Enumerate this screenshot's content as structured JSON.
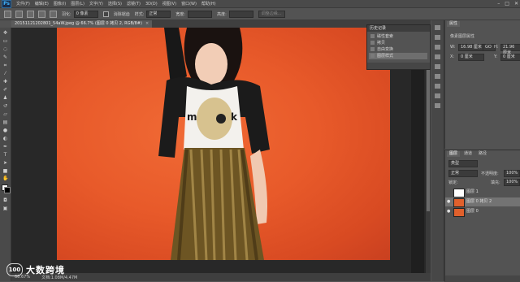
{
  "app": {
    "logo": "Ps"
  },
  "menubar": {
    "items": [
      "文件(F)",
      "编辑(E)",
      "图像(I)",
      "图层(L)",
      "文字(Y)",
      "选择(S)",
      "滤镜(T)",
      "3D(D)",
      "视图(V)",
      "窗口(W)",
      "帮助(H)"
    ],
    "window_controls": [
      "–",
      "□",
      "✕"
    ]
  },
  "optionsbar": {
    "feather_label": "羽化:",
    "feather_value": "0 像素",
    "antialias_label": "消除锯齿",
    "style_label": "样式:",
    "style_value": "正常",
    "width_label": "宽度:",
    "height_label": "高度:",
    "refine_button": "调整边缘..."
  },
  "document": {
    "tab_title": "20151121202801_54aW.jpeg @ 66.7% (图层 0 拷贝 2, RGB/8#)",
    "zoom": "66.67%",
    "info": "文档:1.08M/4.47M"
  },
  "watermark": {
    "logo": "100",
    "text": "大数跨境"
  },
  "history_panel": {
    "tabs": [
      "历史记录"
    ],
    "items": [
      {
        "label": "磁性套索",
        "active": false
      },
      {
        "label": "拷贝",
        "active": false
      },
      {
        "label": "自由变换",
        "active": false
      },
      {
        "label": "图层样式",
        "active": true
      }
    ]
  },
  "properties_panel": {
    "tab": "属性",
    "title": "像素图层属性",
    "w_label": "W:",
    "w_value": "16.98 厘米",
    "link": "GO",
    "h_label": "H:",
    "h_value": "21.96 厘米",
    "x_label": "X:",
    "x_value": "0 厘米",
    "y_label": "Y:",
    "y_value": "0 厘米"
  },
  "layers_panel": {
    "tabs": [
      "图层",
      "通道",
      "路径"
    ],
    "kind_label": "类型",
    "blend_mode": "正常",
    "opacity_label": "不透明度:",
    "opacity_value": "100%",
    "lock_label": "锁定:",
    "fill_label": "填充:",
    "fill_value": "100%",
    "layers": [
      {
        "name": "图层 1",
        "visible": false,
        "selected": false,
        "thumb": "#ffffff"
      },
      {
        "name": "图层 0 拷贝 2",
        "visible": true,
        "selected": true,
        "thumb": "#e0602c"
      },
      {
        "name": "图层 0",
        "visible": true,
        "selected": false,
        "thumb": "#e0602c"
      }
    ]
  },
  "colors": {
    "background": "#e8582a",
    "accent": "#3fb3ff"
  }
}
